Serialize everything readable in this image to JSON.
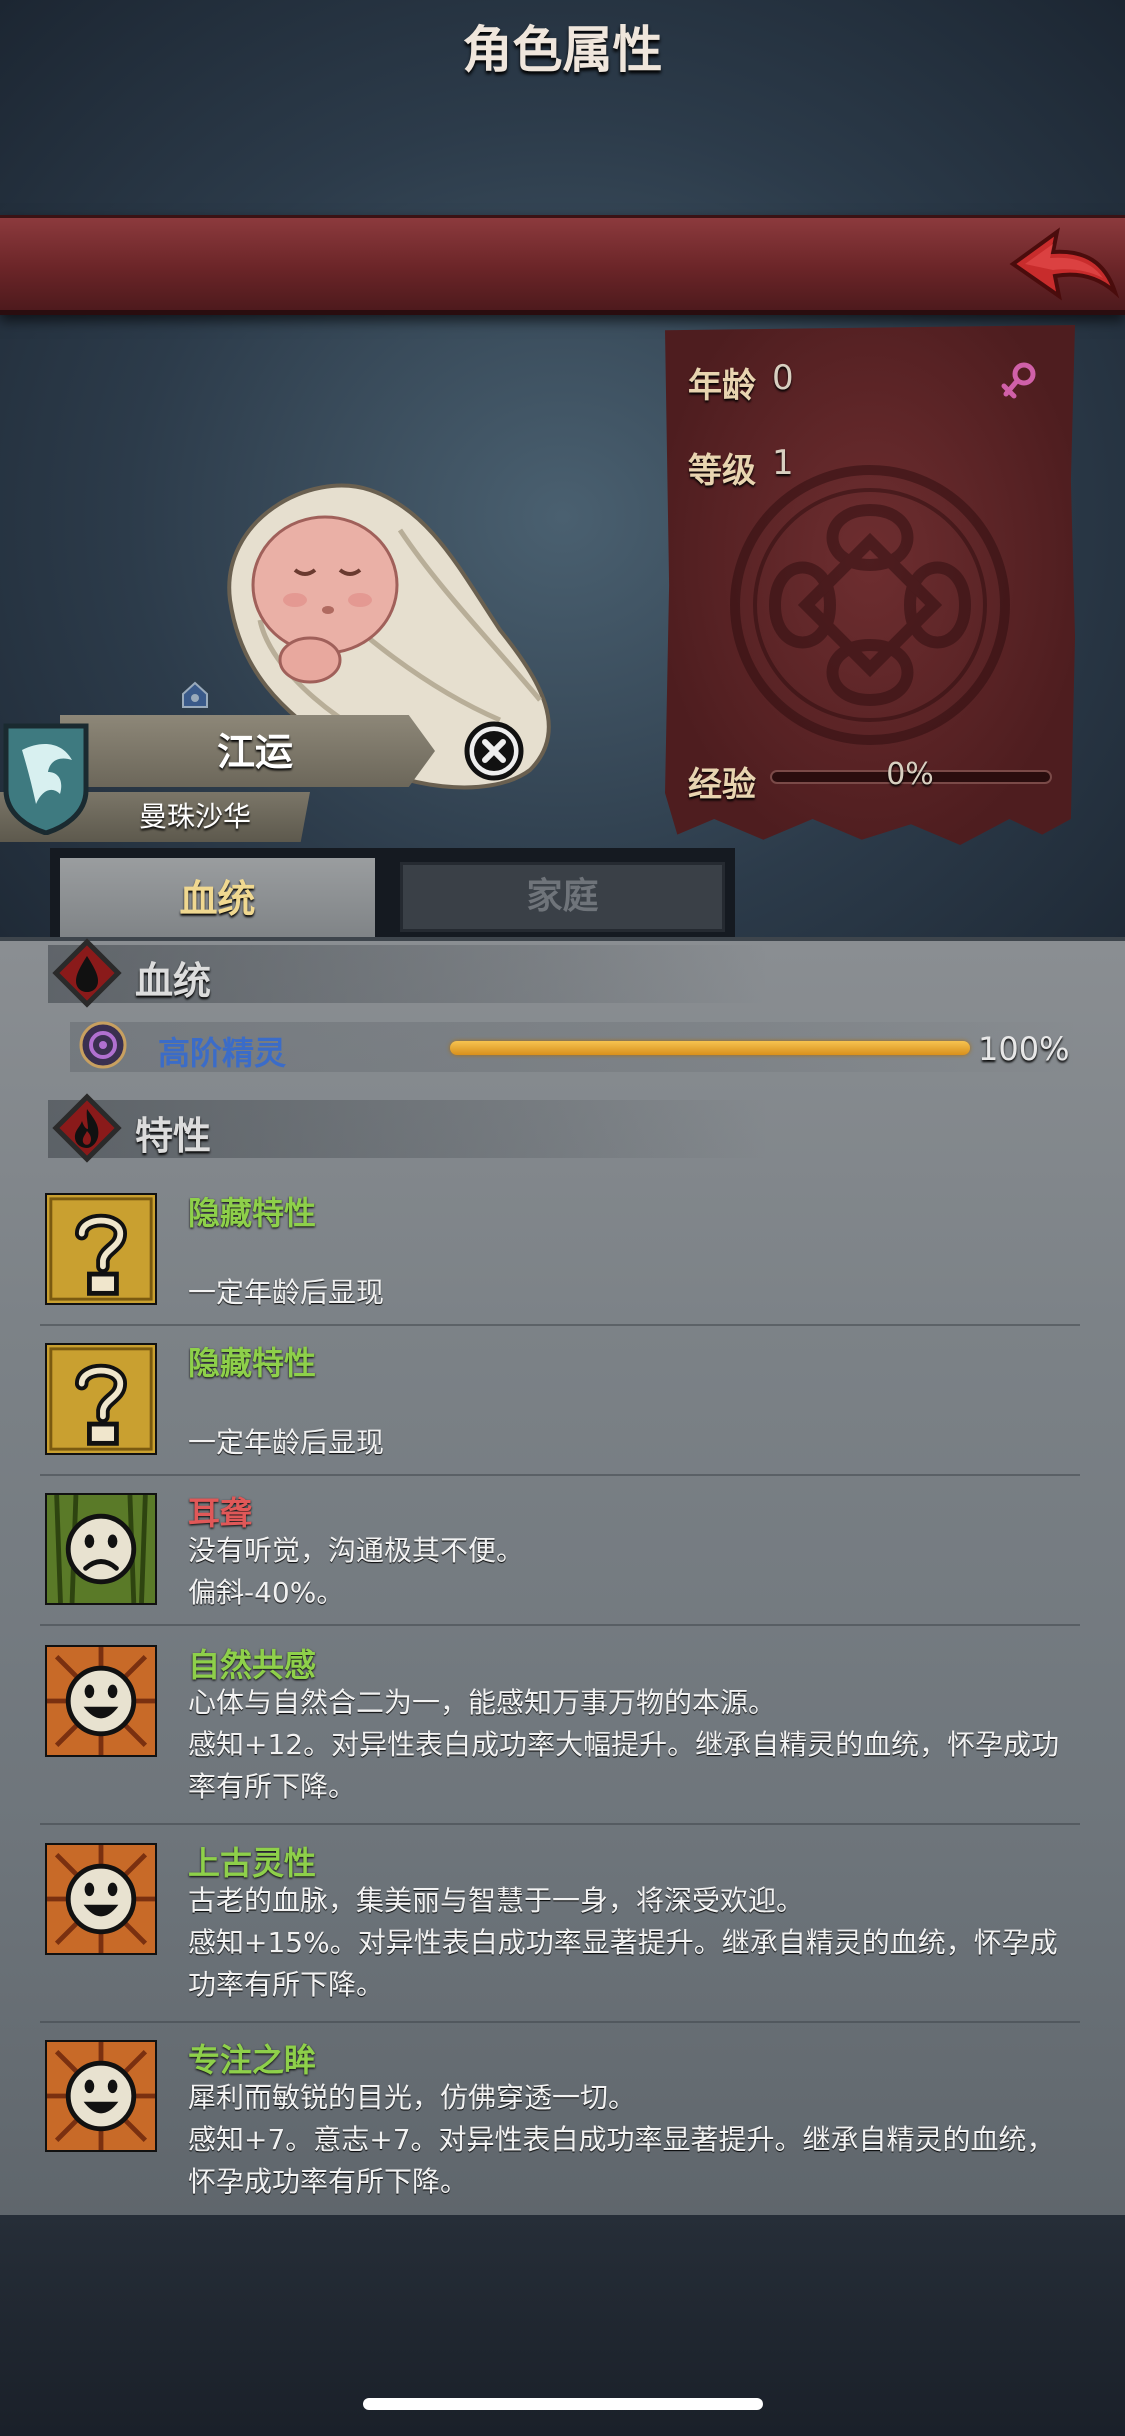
{
  "header": {
    "title": "角色属性"
  },
  "character": {
    "name": "江运",
    "title": "曼珠沙华",
    "stats": {
      "age_label": "年龄",
      "age_value": "0",
      "level_label": "等级",
      "level_value": "1",
      "exp_label": "经验",
      "exp_value": "0%",
      "exp_fraction": 0
    }
  },
  "tabs": [
    {
      "label": "血统",
      "active": true
    },
    {
      "label": "家庭",
      "active": false
    }
  ],
  "bloodline_section": {
    "title": "血统",
    "entries": [
      {
        "name": "高阶精灵",
        "percent": "100%",
        "fraction": 1.0
      }
    ]
  },
  "traits_section": {
    "title": "特性",
    "traits": [
      {
        "name": "隐藏特性",
        "line1": "",
        "line2": "一定年龄后显现",
        "line3": "",
        "icon": "question-icon",
        "color": "green"
      },
      {
        "name": "隐藏特性",
        "line1": "",
        "line2": "一定年龄后显现",
        "line3": "",
        "icon": "question-icon",
        "color": "green"
      },
      {
        "name": "耳聋",
        "line1": "没有听觉，沟通极其不便。",
        "line2": "偏斜-40%。",
        "line3": "",
        "icon": "sad-face-icon",
        "color": "red"
      },
      {
        "name": "自然共感",
        "line1": "心体与自然合二为一，能感知万事万物的本源。",
        "line2": "感知+12。对异性表白成功率大幅提升。继承自精灵的血统，怀孕成功",
        "line3": "率有所下降。",
        "icon": "happy-face-icon",
        "color": "green"
      },
      {
        "name": "上古灵性",
        "line1": "古老的血脉，集美丽与智慧于一身，将深受欢迎。",
        "line2": "感知+15%。对异性表白成功率显著提升。继承自精灵的血统，怀孕成",
        "line3": "功率有所下降。",
        "icon": "happy-face-icon",
        "color": "green"
      },
      {
        "name": "专注之眸",
        "line1": "犀利而敏锐的目光，仿佛穿透一切。",
        "line2": "感知+7。意志+7。对异性表白成功率显著提升。继承自精灵的血统，",
        "line3": "怀孕成功率有所下降。",
        "icon": "happy-face-icon",
        "color": "green"
      }
    ]
  },
  "colors": {
    "banner": "#6b2528",
    "green_name": "#8ed04a",
    "red_name": "#e05858",
    "bloodline_blue": "#3b6cc8",
    "bar_gold": "#e8a838"
  }
}
